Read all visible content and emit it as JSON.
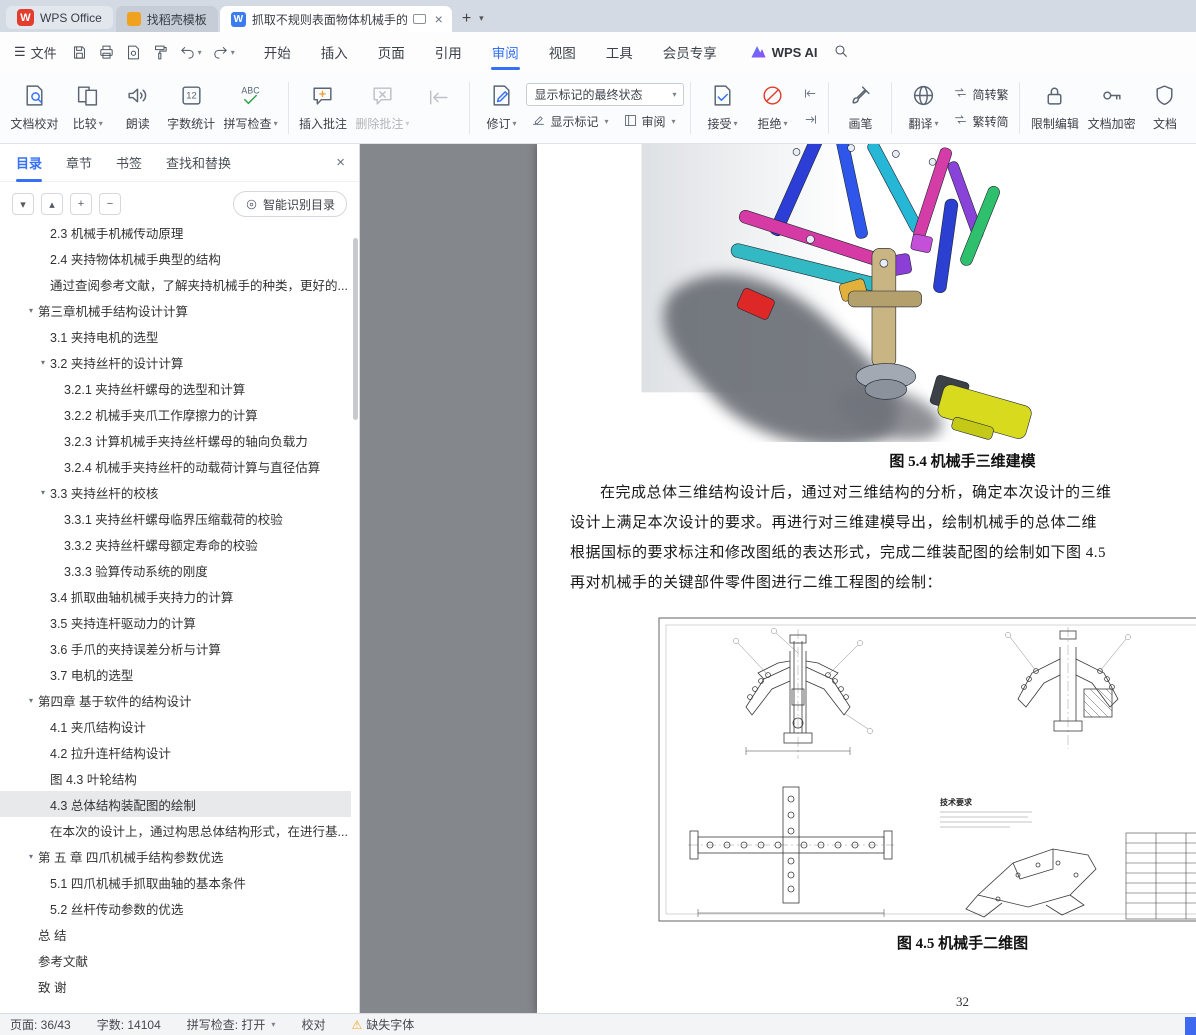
{
  "titlebar": {
    "home_tab": "WPS Office",
    "docer_tab": "找稻壳模板",
    "doc_tab": "抓取不规则表面物体机械手的",
    "new_tab": "+"
  },
  "menubar": {
    "file": "文件",
    "tabs": [
      "开始",
      "插入",
      "页面",
      "引用",
      "审阅",
      "视图",
      "工具",
      "会员专享"
    ],
    "wps_ai": "WPS AI"
  },
  "ribbon": {
    "doc_proof": "文档校对",
    "compare": "比较",
    "read_aloud": "朗读",
    "word_count": "字数统计",
    "spell_check": "拼写检查",
    "insert_comment": "插入批注",
    "delete_comment": "删除批注",
    "revision": "修订",
    "marks_state": "显示标记的最终状态",
    "show_marks": "显示标记",
    "review": "审阅",
    "accept": "接受",
    "reject": "拒绝",
    "brush": "画笔",
    "translate": "翻译",
    "jian_to_fan": "简转繁",
    "fan_to_jian": "繁转简",
    "restrict_edit": "限制编辑",
    "doc_encrypt": "文档加密",
    "doc_clipped": "文档"
  },
  "sidebar": {
    "tabs": [
      "目录",
      "章节",
      "书签",
      "查找和替换"
    ],
    "smart_toc": "智能识别目录",
    "toc": [
      {
        "text": "2.3 机械手机械传动原理",
        "level": 2
      },
      {
        "text": "2.4 夹持物体机械手典型的结构",
        "level": 2
      },
      {
        "text": "通过查阅参考文献，了解夹持机械手的种类，更好的...",
        "level": 2
      },
      {
        "text": "第三章机械手结构设计计算",
        "level": 1,
        "arrow": true
      },
      {
        "text": "3.1 夹持电机的选型",
        "level": 2
      },
      {
        "text": "3.2 夹持丝杆的设计计算",
        "level": 2,
        "arrow": true
      },
      {
        "text": "3.2.1 夹持丝杆螺母的选型和计算",
        "level": 3
      },
      {
        "text": "3.2.2 机械手夹爪工作摩擦力的计算",
        "level": 3
      },
      {
        "text": "3.2.3 计算机械手夹持丝杆螺母的轴向负载力",
        "level": 3
      },
      {
        "text": "3.2.4 机械手夹持丝杆的动载荷计算与直径估算",
        "level": 3
      },
      {
        "text": "3.3 夹持丝杆的校核",
        "level": 2,
        "arrow": true
      },
      {
        "text": "3.3.1 夹持丝杆螺母临界压缩载荷的校验",
        "level": 3
      },
      {
        "text": "3.3.2 夹持丝杆螺母额定寿命的校验",
        "level": 3
      },
      {
        "text": "3.3.3 验算传动系统的刚度",
        "level": 3
      },
      {
        "text": "3.4 抓取曲轴机械手夹持力的计算",
        "level": 2
      },
      {
        "text": "3.5 夹持连杆驱动力的计算",
        "level": 2
      },
      {
        "text": "3.6 手爪的夹持误差分析与计算",
        "level": 2
      },
      {
        "text": "3.7 电机的选型",
        "level": 2
      },
      {
        "text": "第四章 基于软件的结构设计",
        "level": 1,
        "arrow": true
      },
      {
        "text": "4.1 夹爪结构设计",
        "level": 2
      },
      {
        "text": "4.2 拉升连杆结构设计",
        "level": 2
      },
      {
        "text": "图 4.3 叶轮结构",
        "level": 2
      },
      {
        "text": "4.3 总体结构装配图的绘制",
        "level": 2,
        "selected": true
      },
      {
        "text": "在本次的设计上，通过构思总体结构形式，在进行基...",
        "level": 2
      },
      {
        "text": "第 五 章 四爪机械手结构参数优选",
        "level": 1,
        "arrow": true
      },
      {
        "text": "5.1 四爪机械手抓取曲轴的基本条件",
        "level": 2
      },
      {
        "text": "5.2 丝杆传动参数的优选",
        "level": 2
      },
      {
        "text": "总 结",
        "level": 1
      },
      {
        "text": "参考文献",
        "level": 1
      },
      {
        "text": "致 谢",
        "level": 1
      }
    ]
  },
  "doc": {
    "fig1_caption": "图 5.4 机械手三维建模",
    "paragraph": [
      "在完成总体三维结构设计后，通过对三维结构的分析，确定本次设计的三维",
      "设计上满足本次设计的要求。再进行对三维建模导出，绘制机械手的总体二维",
      "根据国标的要求标注和修改图纸的表达形式，完成二维装配图的绘制如下图 4.5",
      "再对机械手的关键部件零件图进行二维工程图的绘制："
    ],
    "drawing_note": "技术要求",
    "fig2_caption": "图 4.5 机械手二维图",
    "page_number": "32"
  },
  "statusbar": {
    "page": "页面: 36/43",
    "words": "字数: 14104",
    "spell": "拼写检查: 打开",
    "proof": "校对",
    "missing_font": "缺失字体"
  },
  "colors": {
    "accent_blue": "#3670f6",
    "wps_red": "#e23d2e",
    "warning_orange": "#f5a623"
  }
}
